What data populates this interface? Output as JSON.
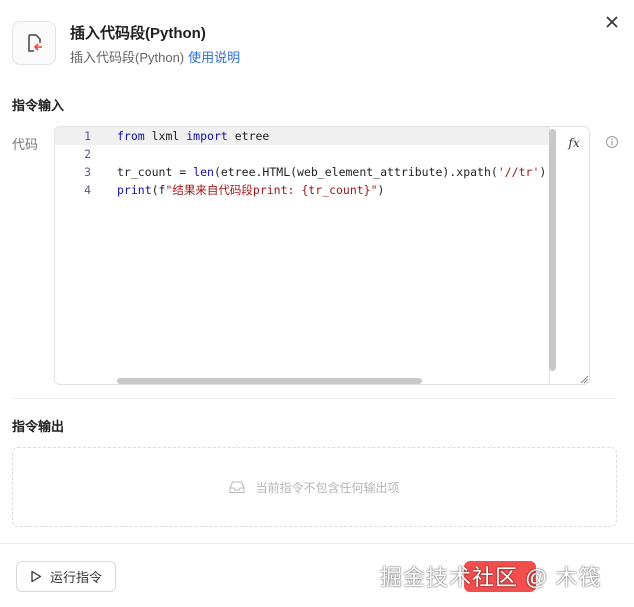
{
  "header": {
    "title": "插入代码段(Python)",
    "subtitle": "插入代码段(Python)",
    "help_link": "使用说明",
    "icon": "code-snippet-icon",
    "close_icon": "close-icon"
  },
  "input_section": {
    "title": "指令输入",
    "code_label": "代码",
    "fx_label": "fx",
    "lines": [
      {
        "number": "1",
        "parts": [
          {
            "t": "from",
            "c": "kw"
          },
          {
            "t": " lxml ",
            "c": ""
          },
          {
            "t": "import",
            "c": "kw"
          },
          {
            "t": " etree",
            "c": ""
          }
        ]
      },
      {
        "number": "2",
        "parts": []
      },
      {
        "number": "3",
        "parts": [
          {
            "t": "tr_count = ",
            "c": ""
          },
          {
            "t": "len",
            "c": "kw"
          },
          {
            "t": "(etree.HTML(web_element_attribute).xpath(",
            "c": ""
          },
          {
            "t": "'//tr'",
            "c": "str"
          },
          {
            "t": ")",
            "c": ""
          }
        ]
      },
      {
        "number": "4",
        "parts": [
          {
            "t": "print",
            "c": "kw"
          },
          {
            "t": "(f",
            "c": ""
          },
          {
            "t": "\"结果来自代码段print: {tr_count}\"",
            "c": "str"
          },
          {
            "t": ")",
            "c": ""
          }
        ]
      }
    ]
  },
  "output_section": {
    "title": "指令输出",
    "empty_text": "当前指令不包含任何输出项",
    "empty_icon": "inbox-icon"
  },
  "footer": {
    "run_label": "运行指令",
    "run_icon": "play-icon",
    "watermark": "掘金技术社区 @ 木筏"
  },
  "colors": {
    "accent": "#2f6fd6",
    "confirm": "#f24e4e",
    "keyword": "#1010b0",
    "string": "#a31515"
  }
}
